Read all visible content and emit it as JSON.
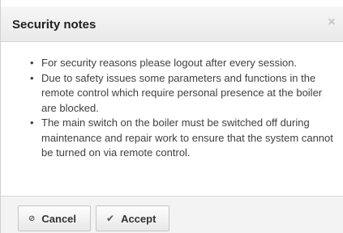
{
  "dialog": {
    "title": "Security notes",
    "close_icon": "×"
  },
  "notes": [
    "For security reasons please logout after every session.",
    "Due to safety issues some parameters and functions in the remote control which require personal presence at the boiler are blocked.",
    "The main switch on the boiler must be switched off during maintenance and repair work to ensure that the system cannot be turned on via remote control."
  ],
  "buttons": {
    "cancel": {
      "icon": "⊘",
      "label": "Cancel"
    },
    "accept": {
      "icon": "✔",
      "label": "Accept"
    }
  }
}
